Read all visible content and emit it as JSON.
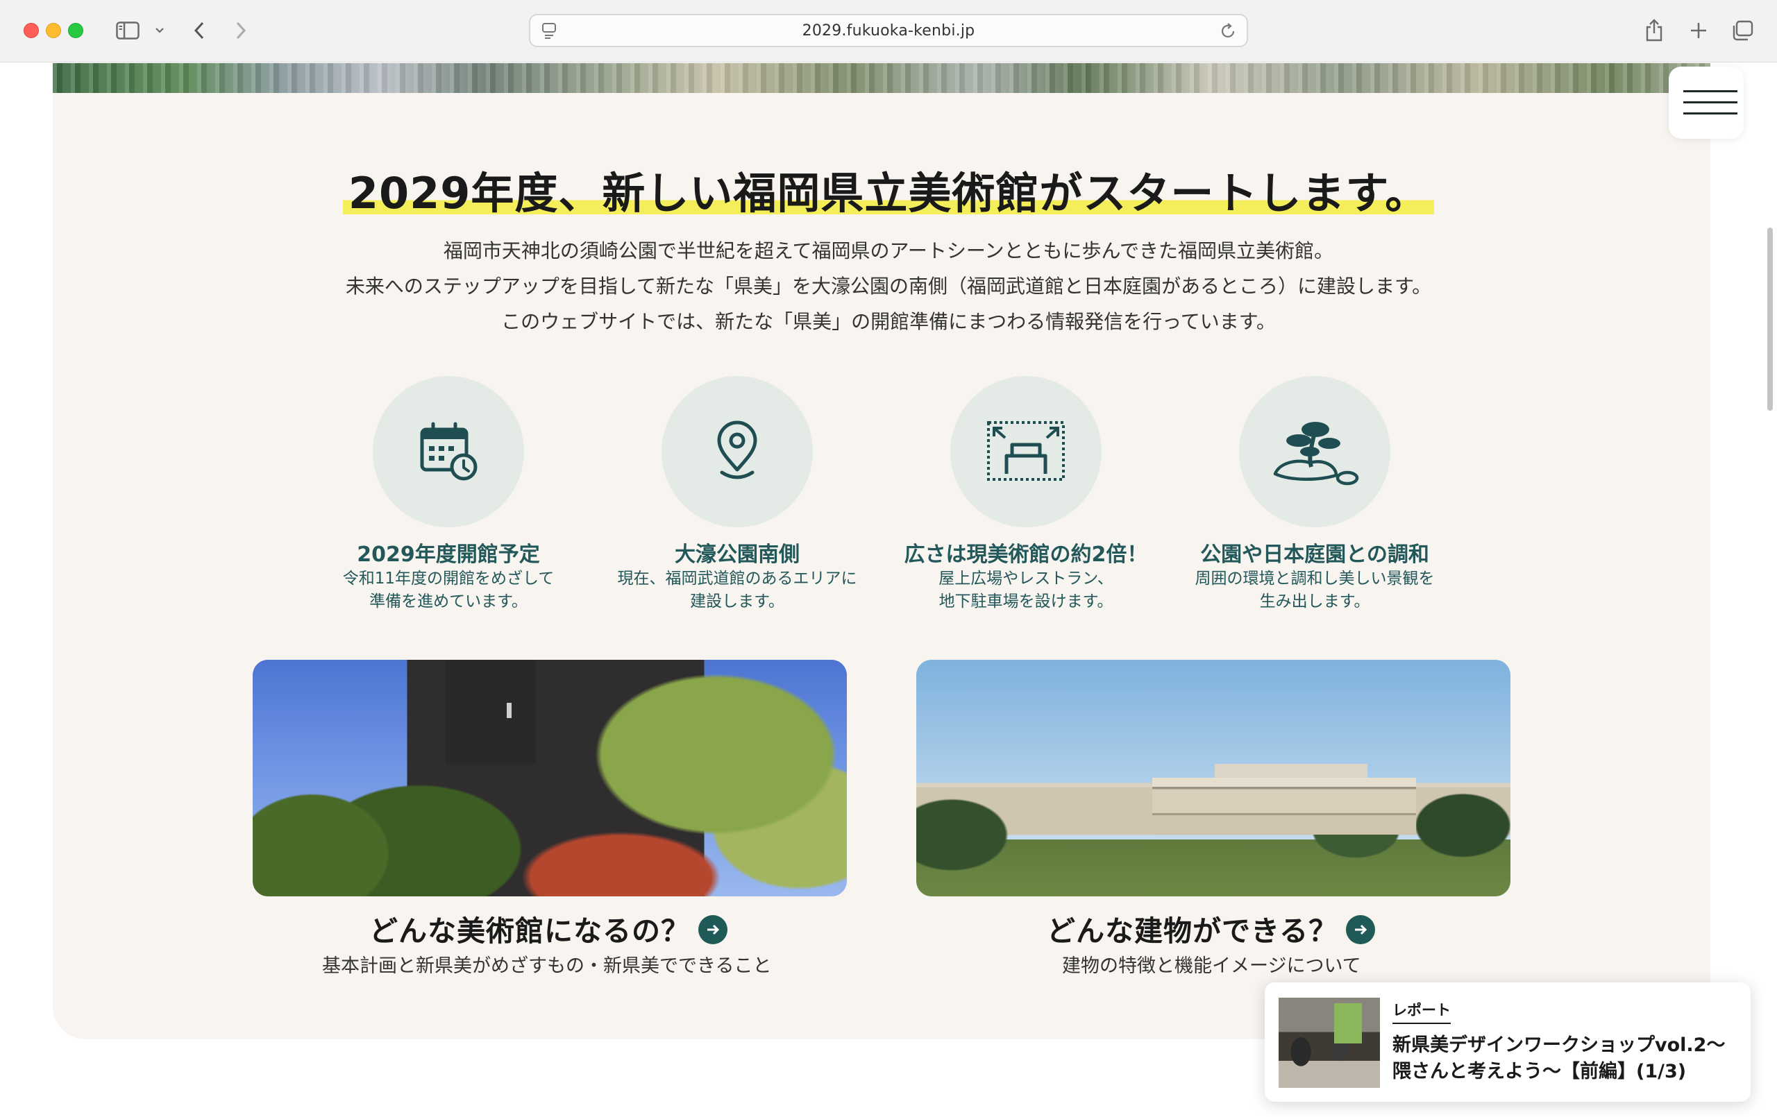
{
  "browser": {
    "url": "2029.fukuoka-kenbi.jp"
  },
  "page": {
    "headline": "2029年度、新しい福岡県立美術館がスタートします。",
    "intro": [
      "福岡市天神北の須崎公園で半世紀を超えて福岡県のアートシーンとともに歩んできた福岡県立美術館。",
      "未来へのステップアップを目指して新たな「県美」を大濠公園の南側（福岡武道館と日本庭園があるところ）に建設します。",
      "このウェブサイトでは、新たな「県美」の開館準備にまつわる情報発信を行っています。"
    ],
    "features": [
      {
        "icon": "calendar-clock-icon",
        "title": "2029年度開館予定",
        "desc": [
          "令和11年度の開館をめざして",
          "準備を進めています。"
        ]
      },
      {
        "icon": "location-pin-icon",
        "title": "大濠公園南側",
        "desc": [
          "現在、福岡武道館のあるエリアに",
          "建設します。"
        ]
      },
      {
        "icon": "expand-area-icon",
        "title": "広さは現美術館の約2倍！",
        "desc": [
          "屋上広場やレストラン、",
          "地下駐車場を設けます。"
        ]
      },
      {
        "icon": "pine-tree-icon",
        "title": "公園や日本庭園との調和",
        "desc": [
          "周囲の環境と調和し美しい景観を",
          "生み出します。"
        ]
      }
    ],
    "cards": [
      {
        "title": "どんな美術館になるの？",
        "sub": "基本計画と新県美がめざすもの・新県美でできること"
      },
      {
        "title": "どんな建物ができる？",
        "sub": "建物の特徴と機能イメージについて"
      }
    ]
  },
  "report": {
    "tag": "レポート",
    "title": "新県美デザインワークショップvol.2〜隈さんと考えよう〜【前編】(1/3)"
  },
  "colors": {
    "accent": "#23585a",
    "highlight": "#f4ee5a",
    "card_bg": "#f8f4f0",
    "icon_circle": "#e4ebe6"
  }
}
